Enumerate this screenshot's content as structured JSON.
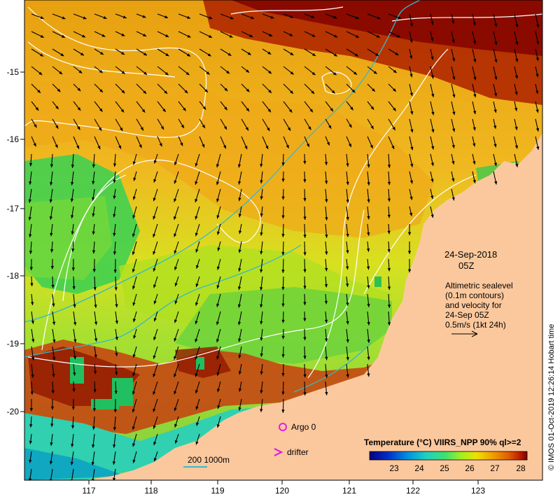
{
  "map": {
    "lon_ticks": [
      "117",
      "118",
      "119",
      "120",
      "121",
      "122",
      "123"
    ],
    "lat_ticks": [
      "-15",
      "-16",
      "-17",
      "-18",
      "-19",
      "-20"
    ],
    "land_color": "#fbc89d",
    "contour_color": "#ffffff",
    "isobath_color": "#38b8c8"
  },
  "annotation": {
    "date": "24-Sep-2018",
    "time": "05Z",
    "lines": [
      "Altimetric sealevel",
      "(0.1m contours)",
      "and velocity for",
      "24-Sep 05Z",
      "0.5m/s (1kt 24h)"
    ]
  },
  "legend": {
    "argo_label": "Argo 0",
    "argo_color": "#e020e0",
    "drifter_label": "drifter",
    "drifter_color": "#e020e0",
    "isobath_label": "200  1000m"
  },
  "colorbar": {
    "title": "Temperature (°C) VIIRS_NPP 90% ql>=2",
    "tick_labels": [
      "23",
      "24",
      "25",
      "26",
      "27",
      "28"
    ],
    "colors": [
      "#000080",
      "#0030c8",
      "#0090e0",
      "#20d0c0",
      "#40e070",
      "#a0f020",
      "#f0e000",
      "#f0a000",
      "#e06000",
      "#c02000",
      "#800000"
    ]
  },
  "credit": "© IMOS 01-Oct-2019 12:26:14 Hobart time"
}
